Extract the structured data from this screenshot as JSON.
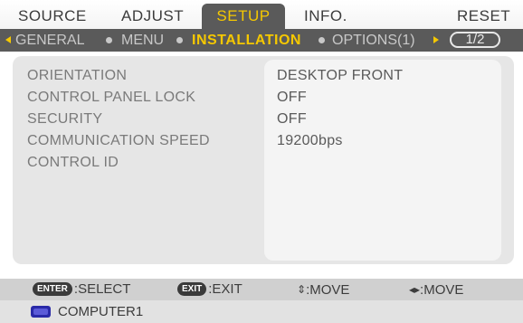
{
  "main_tabs": {
    "source": "SOURCE",
    "adjust": "ADJUST",
    "setup": "SETUP",
    "info": "INFO.",
    "reset": "RESET"
  },
  "sub_tabs": {
    "general": "GENERAL",
    "menu": "MENU",
    "installation": "INSTALLATION",
    "options1": "OPTIONS(1)",
    "page": "1/2"
  },
  "settings": [
    {
      "label": "ORIENTATION",
      "value": "DESKTOP FRONT"
    },
    {
      "label": "CONTROL PANEL LOCK",
      "value": "OFF"
    },
    {
      "label": "SECURITY",
      "value": "OFF"
    },
    {
      "label": "COMMUNICATION SPEED",
      "value": "19200bps"
    },
    {
      "label": "CONTROL ID",
      "value": ""
    }
  ],
  "help": {
    "enter_key": "ENTER",
    "select": ":SELECT",
    "exit_key": "EXIT",
    "exit": ":EXIT",
    "move_v_glyph": "⇕",
    "move_v": ":MOVE",
    "move_h_glyph": "◂▸",
    "move_h": ":MOVE"
  },
  "status": {
    "source_icon": "computer-source-icon",
    "source": "COMPUTER1"
  },
  "colors": {
    "accent": "#f5c800",
    "bar": "#5a5a5a",
    "panel": "#e6e6e6"
  }
}
